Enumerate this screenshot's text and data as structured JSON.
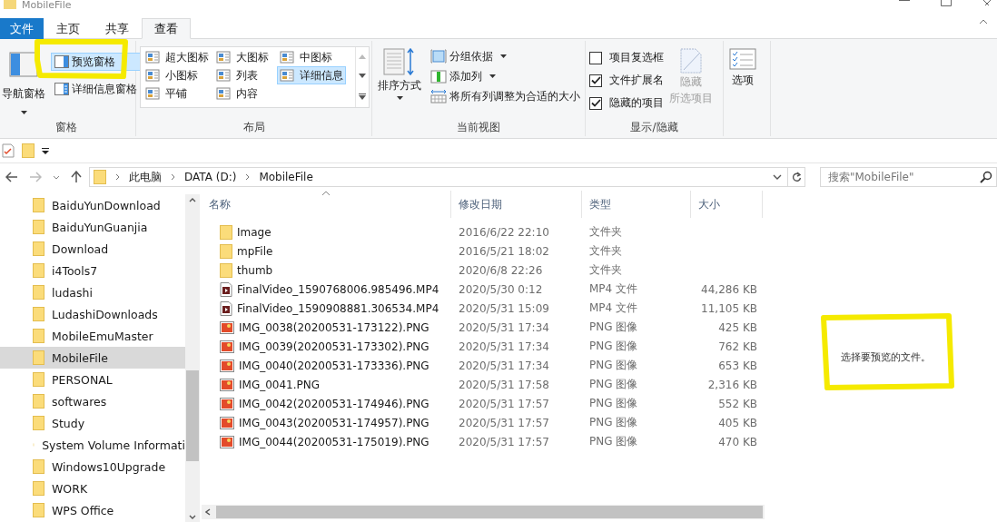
{
  "window": {
    "title": "MobileFile"
  },
  "ribbon_tabs": [
    {
      "label": "文件",
      "kind": "file",
      "selected": false
    },
    {
      "label": "主页",
      "kind": "tab",
      "selected": false
    },
    {
      "label": "共享",
      "kind": "tab",
      "selected": false
    },
    {
      "label": "查看",
      "kind": "tab",
      "selected": true
    }
  ],
  "ribbon": {
    "panes": {
      "label": "窗格",
      "navigation_pane": "导航窗格",
      "preview_pane": {
        "label": "预览窗格",
        "selected": true
      },
      "details_pane": {
        "label": "详细信息窗格",
        "selected": false
      }
    },
    "layout": {
      "label": "布局",
      "options": [
        {
          "label": "超大图标",
          "selected": false
        },
        {
          "label": "大图标",
          "selected": false
        },
        {
          "label": "中图标",
          "selected": false
        },
        {
          "label": "小图标",
          "selected": false
        },
        {
          "label": "列表",
          "selected": false
        },
        {
          "label": "详细信息",
          "selected": true
        },
        {
          "label": "平铺",
          "selected": false
        },
        {
          "label": "内容",
          "selected": false
        }
      ]
    },
    "current_view": {
      "label": "当前视图",
      "sort_by": "排序方式",
      "group_by": "分组依据",
      "add_columns": "添加列",
      "size_all_columns": "将所有列调整为合适的大小"
    },
    "show_hide": {
      "label": "显示/隐藏",
      "checkboxes": [
        {
          "label": "项目复选框",
          "checked": false
        },
        {
          "label": "文件扩展名",
          "checked": true
        },
        {
          "label": "隐藏的项目",
          "checked": true
        }
      ],
      "hide_selected": {
        "label": "隐藏",
        "sublabel": "所选项目",
        "disabled": true
      }
    },
    "options": {
      "label": "选项"
    }
  },
  "address_bar": {
    "path": [
      "此电脑",
      "DATA (D:)",
      "MobileFile"
    ]
  },
  "search": {
    "placeholder": "搜索\"MobileFile\""
  },
  "sidebar": {
    "items": [
      {
        "label": "BaiduYunDownload",
        "selected": false,
        "hidden": false
      },
      {
        "label": "BaiduYunGuanjia",
        "selected": false,
        "hidden": false
      },
      {
        "label": "Download",
        "selected": false,
        "hidden": false
      },
      {
        "label": "i4Tools7",
        "selected": false,
        "hidden": false
      },
      {
        "label": "ludashi",
        "selected": false,
        "hidden": false
      },
      {
        "label": "LudashiDownloads",
        "selected": false,
        "hidden": false
      },
      {
        "label": "MobileEmuMaster",
        "selected": false,
        "hidden": false
      },
      {
        "label": "MobileFile",
        "selected": true,
        "hidden": false
      },
      {
        "label": "PERSONAL",
        "selected": false,
        "hidden": false
      },
      {
        "label": "softwares",
        "selected": false,
        "hidden": false
      },
      {
        "label": "Study",
        "selected": false,
        "hidden": false
      },
      {
        "label": "System Volume Informati",
        "selected": false,
        "hidden": true
      },
      {
        "label": "Windows10Upgrade",
        "selected": false,
        "hidden": false
      },
      {
        "label": "WORK",
        "selected": false,
        "hidden": false
      },
      {
        "label": "WPS Office",
        "selected": false,
        "hidden": false
      }
    ]
  },
  "table": {
    "columns": [
      {
        "label": "名称",
        "sorted": true
      },
      {
        "label": "修改日期",
        "sorted": false
      },
      {
        "label": "类型",
        "sorted": false
      },
      {
        "label": "大小",
        "sorted": false
      }
    ],
    "rows": [
      {
        "kind": "folder",
        "name": "Image",
        "date": "2016/6/22 22:10",
        "type": "文件夹"
      },
      {
        "kind": "folder",
        "name": "mpFile",
        "date": "2016/5/21 18:02",
        "type": "文件夹"
      },
      {
        "kind": "folder",
        "name": "thumb",
        "date": "2020/6/8 22:26",
        "type": "文件夹"
      },
      {
        "kind": "video",
        "name": "FinalVideo_1590768006.985496.MP4",
        "date": "2020/5/30 0:12",
        "type": "MP4 文件",
        "size": "44,286 KB"
      },
      {
        "kind": "video",
        "name": "FinalVideo_1590908881.306534.MP4",
        "date": "2020/5/31 15:09",
        "type": "MP4 文件",
        "size": "11,105 KB"
      },
      {
        "kind": "image",
        "name": "IMG_0038(20200531-173122).PNG",
        "date": "2020/5/31 17:34",
        "type": "PNG 图像",
        "size": "425 KB"
      },
      {
        "kind": "image",
        "name": "IMG_0039(20200531-173302).PNG",
        "date": "2020/5/31 17:34",
        "type": "PNG 图像",
        "size": "762 KB"
      },
      {
        "kind": "image",
        "name": "IMG_0040(20200531-173336).PNG",
        "date": "2020/5/31 17:34",
        "type": "PNG 图像",
        "size": "653 KB"
      },
      {
        "kind": "image",
        "name": "IMG_0041.PNG",
        "date": "2020/5/31 17:58",
        "type": "PNG 图像",
        "size": "2,316 KB"
      },
      {
        "kind": "image",
        "name": "IMG_0042(20200531-174946).PNG",
        "date": "2020/5/31 17:57",
        "type": "PNG 图像",
        "size": "552 KB"
      },
      {
        "kind": "image",
        "name": "IMG_0043(20200531-174957).PNG",
        "date": "2020/5/31 17:57",
        "type": "PNG 图像",
        "size": "405 KB"
      },
      {
        "kind": "image",
        "name": "IMG_0044(20200531-175019).PNG",
        "date": "2020/5/31 17:57",
        "type": "PNG 图像",
        "size": "470 KB"
      }
    ]
  },
  "preview_pane": {
    "message": "选择要预览的文件。"
  }
}
